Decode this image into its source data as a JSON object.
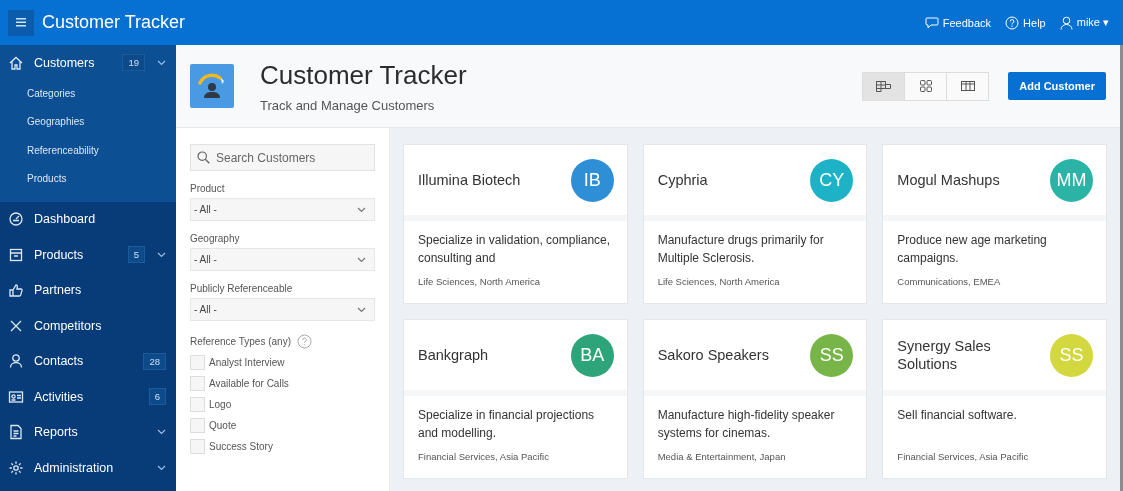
{
  "header": {
    "title": "Customer Tracker",
    "links": [
      {
        "kind": "feedback",
        "label": "Feedback"
      },
      {
        "kind": "help",
        "label": "Help"
      },
      {
        "kind": "user",
        "label": "mike ▾"
      }
    ]
  },
  "sidebar": {
    "items": [
      {
        "label": "Customers",
        "badge": "19",
        "expanded": true,
        "children": [
          {
            "label": "Categories"
          },
          {
            "label": "Geographies"
          },
          {
            "label": "Referenceability"
          },
          {
            "label": "Products"
          }
        ]
      },
      {
        "label": "Dashboard"
      },
      {
        "label": "Products",
        "badge": "5",
        "expanded": false
      },
      {
        "label": "Partners"
      },
      {
        "label": "Competitors"
      },
      {
        "label": "Contacts",
        "badge": "28"
      },
      {
        "label": "Activities",
        "badge": "6"
      },
      {
        "label": "Reports",
        "expanded": false
      },
      {
        "label": "Administration",
        "expanded": false
      }
    ]
  },
  "hero": {
    "title": "Customer Tracker",
    "subtitle": "Track and Manage Customers",
    "views": [
      {
        "kind": "cards",
        "selected": true
      },
      {
        "kind": "grid",
        "selected": false
      },
      {
        "kind": "table",
        "selected": false
      }
    ],
    "add_button": "Add Customer"
  },
  "filters": {
    "search": {
      "placeholder": "Search Customers"
    },
    "selects": [
      {
        "label": "Product",
        "value": "- All -"
      },
      {
        "label": "Geography",
        "value": "- All -"
      },
      {
        "label": "Publicly Referenceable",
        "value": "- All -"
      }
    ],
    "reference_types": {
      "label": "Reference Types (any)",
      "options": [
        {
          "label": "Analyst Interview",
          "checked": false
        },
        {
          "label": "Available for Calls",
          "checked": false
        },
        {
          "label": "Logo",
          "checked": false
        },
        {
          "label": "Quote",
          "checked": false
        },
        {
          "label": "Success Story",
          "checked": false
        }
      ]
    }
  },
  "customers": [
    {
      "name": "Illumina Biotech",
      "initials": "IB",
      "color": "#2e8fd6",
      "description": "Specialize in validation, compliance, consulting and",
      "tags": "Life Sciences, North America"
    },
    {
      "name": "Cyphria",
      "initials": "CY",
      "color": "#1eb2c7",
      "description": "Manufacture drugs primarily for Multiple Sclerosis.",
      "tags": "Life Sciences, North America"
    },
    {
      "name": "Mogul Mashups",
      "initials": "MM",
      "color": "#2bb3a6",
      "description": "Produce new age marketing campaigns.",
      "tags": "Communications, EMEA"
    },
    {
      "name": "Bankgraph",
      "initials": "BA",
      "color": "#2ea47a",
      "description": "Specialize in financial projections and modelling.",
      "tags": "Financial Services, Asia Pacific"
    },
    {
      "name": "Sakoro Speakers",
      "initials": "SS",
      "color": "#78b548",
      "description": "Manufacture high-fidelity speaker systems for cinemas.",
      "tags": "Media & Entertainment, Japan"
    },
    {
      "name": "Synergy Sales Solutions",
      "initials": "SS",
      "color": "#d3d83e",
      "description": "Sell financial software.",
      "tags": "Financial Services, Asia Pacific"
    }
  ]
}
